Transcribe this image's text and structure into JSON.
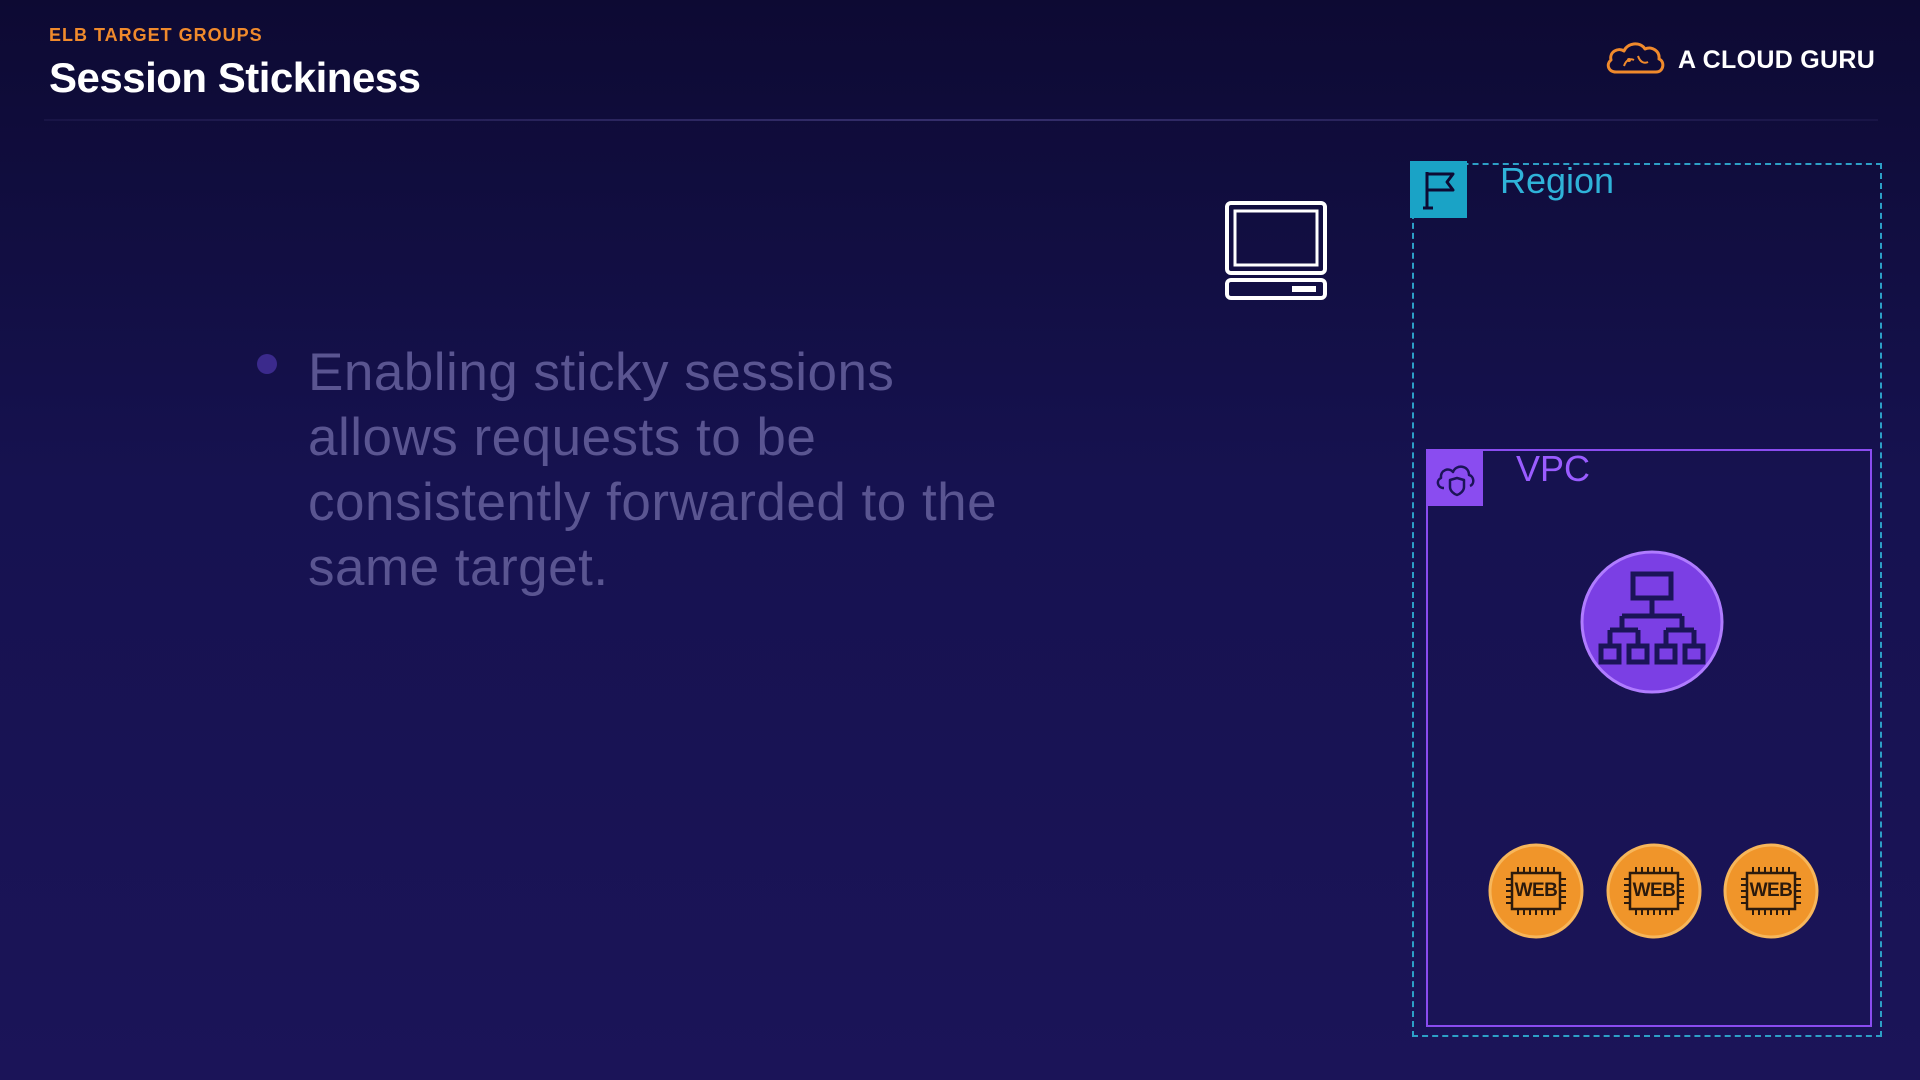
{
  "header": {
    "eyebrow": "ELB TARGET GROUPS",
    "title": "Session Stickiness"
  },
  "brand": {
    "name": "A CLOUD GURU",
    "icon": "cloud-logo-icon",
    "color": "#f08a2c"
  },
  "bullets": [
    {
      "text": "Enabling sticky sessions allows requests to be consistently forwarded to the same target."
    }
  ],
  "diagram": {
    "client_icon": "laptop-icon",
    "region": {
      "label": "Region",
      "icon": "flag-icon",
      "color": "#1aa3c6"
    },
    "vpc": {
      "label": "VPC",
      "icon": "cloud-shield-icon",
      "color": "#8a4cf0"
    },
    "load_balancer": {
      "icon": "load-balancer-icon",
      "color": "#8a4cf0"
    },
    "web_servers": [
      {
        "label": "WEB"
      },
      {
        "label": "WEB"
      },
      {
        "label": "WEB"
      }
    ],
    "web_color": "#f0952a"
  }
}
